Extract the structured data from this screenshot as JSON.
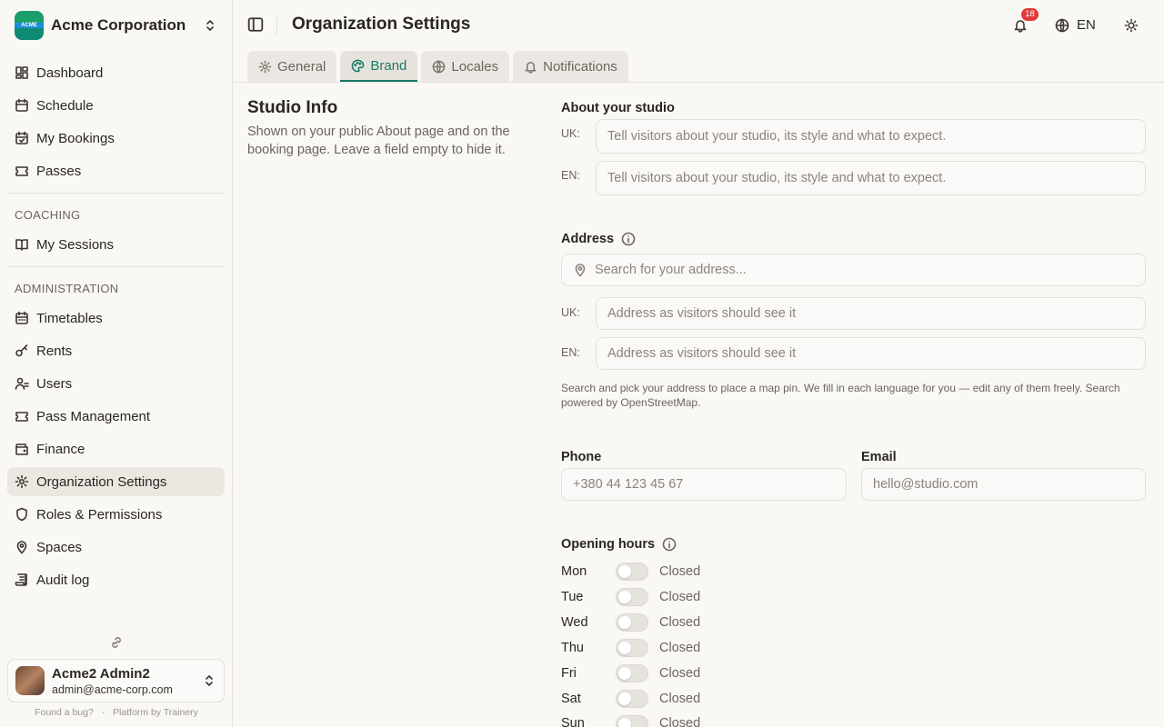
{
  "org": {
    "name": "Acme Corporation",
    "logo_text": "ACME"
  },
  "nav": {
    "main": [
      {
        "label": "Dashboard",
        "icon": "dashboard-icon"
      },
      {
        "label": "Schedule",
        "icon": "calendar-icon"
      },
      {
        "label": "My Bookings",
        "icon": "calendar-check-icon"
      },
      {
        "label": "Passes",
        "icon": "ticket-icon"
      }
    ],
    "coaching_label": "COACHING",
    "coaching": [
      {
        "label": "My Sessions",
        "icon": "book-open-icon"
      }
    ],
    "admin_label": "ADMINISTRATION",
    "admin": [
      {
        "label": "Timetables",
        "icon": "calendar-grid-icon"
      },
      {
        "label": "Rents",
        "icon": "key-icon"
      },
      {
        "label": "Users",
        "icon": "users-icon"
      },
      {
        "label": "Pass Management",
        "icon": "ticket-icon"
      },
      {
        "label": "Finance",
        "icon": "wallet-icon"
      },
      {
        "label": "Organization Settings",
        "icon": "gear-icon"
      },
      {
        "label": "Roles & Permissions",
        "icon": "shield-icon"
      },
      {
        "label": "Spaces",
        "icon": "map-pin-icon"
      },
      {
        "label": "Audit log",
        "icon": "scroll-icon"
      }
    ]
  },
  "user": {
    "name": "Acme2 Admin2",
    "email": "admin@acme-corp.com"
  },
  "footer": {
    "bug": "Found a bug?",
    "sep": "·",
    "platform": "Platform by Trainery"
  },
  "header": {
    "title": "Organization Settings",
    "notifications_count": "18",
    "language": "EN"
  },
  "tabs": [
    {
      "label": "General",
      "icon": "gear-icon"
    },
    {
      "label": "Brand",
      "icon": "palette-icon"
    },
    {
      "label": "Locales",
      "icon": "globe-icon"
    },
    {
      "label": "Notifications",
      "icon": "bell-icon"
    }
  ],
  "studio": {
    "title": "Studio Info",
    "description": "Shown on your public About page and on the booking page. Leave a field empty to hide it.",
    "about_label": "About your studio",
    "lang_uk": "UK:",
    "lang_en": "EN:",
    "about_placeholder": "Tell visitors about your studio, its style and what to expect.",
    "address_label": "Address",
    "address_search_placeholder": "Search for your address...",
    "address_placeholder": "Address as visitors should see it",
    "address_hint": "Search and pick your address to place a map pin. We fill in each language for you — edit any of them freely. Search powered by OpenStreetMap.",
    "phone_label": "Phone",
    "phone_placeholder": "+380 44 123 45 67",
    "email_label": "Email",
    "email_placeholder": "hello@studio.com",
    "hours_label": "Opening hours",
    "days": [
      {
        "day": "Mon",
        "status": "Closed"
      },
      {
        "day": "Tue",
        "status": "Closed"
      },
      {
        "day": "Wed",
        "status": "Closed"
      },
      {
        "day": "Thu",
        "status": "Closed"
      },
      {
        "day": "Fri",
        "status": "Closed"
      },
      {
        "day": "Sat",
        "status": "Closed"
      },
      {
        "day": "Sun",
        "status": "Closed"
      }
    ]
  }
}
